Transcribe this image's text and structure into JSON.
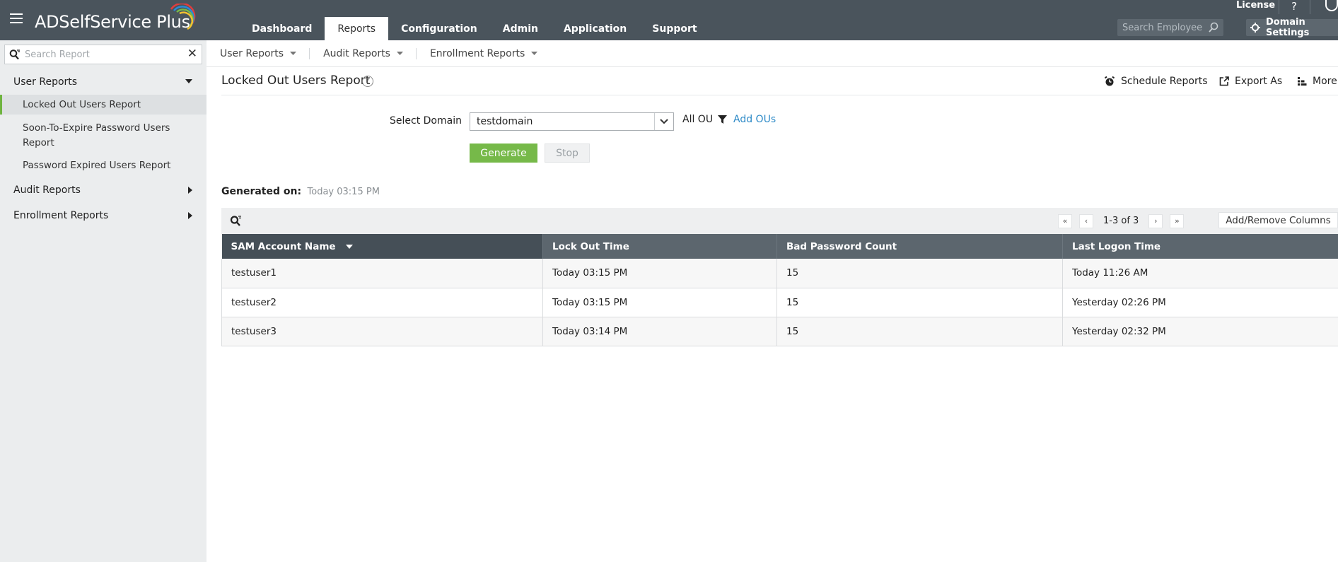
{
  "app": {
    "title": "ADSelfService Plus",
    "brand_color": "#76b949",
    "topbar_color": "#4a545c"
  },
  "nav": {
    "tabs": [
      {
        "label": "Dashboard",
        "active": false
      },
      {
        "label": "Reports",
        "active": true
      },
      {
        "label": "Configuration",
        "active": false
      },
      {
        "label": "Admin",
        "active": false
      },
      {
        "label": "Application",
        "active": false
      },
      {
        "label": "Support",
        "active": false
      }
    ],
    "license_label": "License",
    "help_label": "?",
    "employee_search_placeholder": "Search Employee",
    "domain_settings_label": "Domain Settings"
  },
  "sidebar": {
    "search_placeholder": "Search Report",
    "groups": [
      {
        "label": "User Reports",
        "expanded": true
      },
      {
        "label": "Audit Reports",
        "expanded": false
      },
      {
        "label": "Enrollment Reports",
        "expanded": false
      }
    ],
    "items": [
      {
        "label": "Locked Out Users Report",
        "active": true
      },
      {
        "label": "Soon-To-Expire Password Users Report",
        "active": false
      },
      {
        "label": "Password Expired Users Report",
        "active": false
      }
    ]
  },
  "subnav": {
    "items": [
      "User Reports",
      "Audit Reports",
      "Enrollment Reports"
    ]
  },
  "report": {
    "title": "Locked Out Users Report",
    "help_icon": "?",
    "actions": {
      "schedule": "Schedule Reports",
      "export": "Export As",
      "more": "More"
    },
    "select_domain_label": "Select Domain",
    "domain_value": "testdomain",
    "all_ou_label": "All OU",
    "add_ous_label": "Add OUs",
    "generate_label": "Generate",
    "stop_label": "Stop",
    "generated_on_label": "Generated on:",
    "generated_on_value": "Today 03:15 PM"
  },
  "grid": {
    "pager_info": "1-3 of 3",
    "add_remove_columns": "Add/Remove Columns",
    "columns": [
      "SAM Account Name",
      "Lock Out Time",
      "Bad Password Count",
      "Last Logon Time"
    ],
    "rows": [
      {
        "sam": "testuser1",
        "lockout": "Today 03:15 PM",
        "bad": "15",
        "logon": "Today 11:26 AM"
      },
      {
        "sam": "testuser2",
        "lockout": "Today 03:15 PM",
        "bad": "15",
        "logon": "Yesterday 02:26 PM"
      },
      {
        "sam": "testuser3",
        "lockout": "Today 03:14 PM",
        "bad": "15",
        "logon": "Yesterday 02:32 PM"
      }
    ]
  }
}
